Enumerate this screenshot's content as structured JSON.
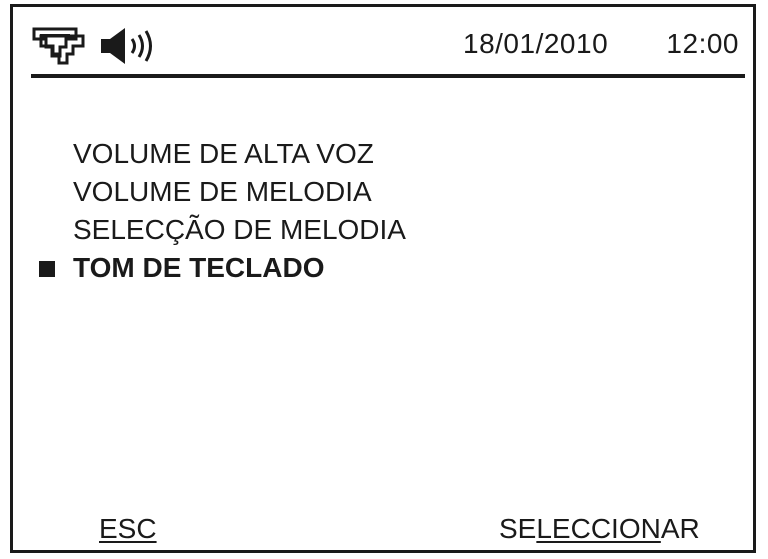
{
  "status_bar": {
    "icons": [
      "phone-network-icon",
      "speaker-volume-icon"
    ],
    "date": "18/01/2010",
    "time": "12:00"
  },
  "menu": {
    "items": [
      {
        "label": "VOLUME DE ALTA VOZ",
        "selected": false
      },
      {
        "label": "VOLUME DE MELODIA",
        "selected": false
      },
      {
        "label": "SELECÇÃO DE MELODIA",
        "selected": false
      },
      {
        "label": "TOM DE TECLADO",
        "selected": true
      }
    ]
  },
  "softkeys": {
    "left": "ESC",
    "right_prefix": "SE",
    "right_underlined": "LECCION",
    "right_suffix": "AR"
  }
}
